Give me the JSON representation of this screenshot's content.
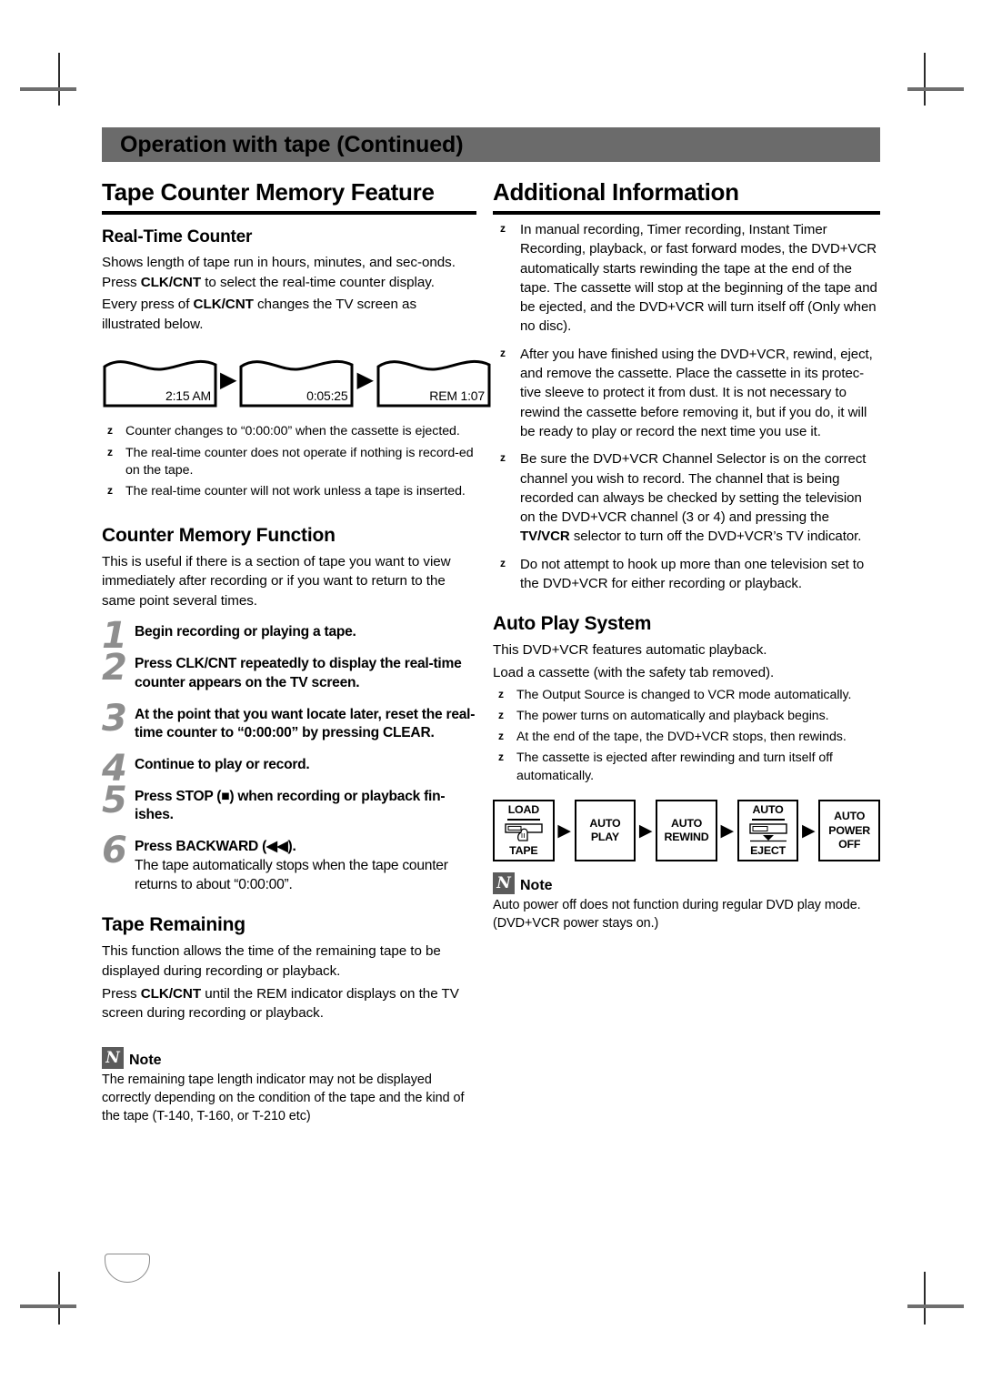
{
  "banner": {
    "title": "Operation with tape (Continued)"
  },
  "left": {
    "section_title": "Tape Counter Memory Feature",
    "realtime": {
      "heading": "Real-Time Counter",
      "p1_a": "Shows length of tape run in hours, minutes, and sec-onds. Press ",
      "p1_b": "CLK/CNT",
      "p1_c": " to select the real-time counter display.",
      "p2_a": "Every press of ",
      "p2_b": "CLK/CNT",
      "p2_c": " changes the TV screen as illustrated below.",
      "screens": [
        {
          "value": "2:15 AM"
        },
        {
          "value": "0:05:25"
        },
        {
          "value": "REM 1:07"
        }
      ],
      "arrow_glyph": "▶",
      "bullets": [
        "Counter changes to “0:00:00” when the cassette is ejected.",
        "The real-time counter does not operate if nothing is record-ed on the tape.",
        "The real-time counter will not work unless a tape is inserted."
      ]
    },
    "memory": {
      "heading": "Counter Memory Function",
      "intro": "This is useful if there is a section of tape you want to view immediately after recording or if you want to return to the same point several times.",
      "steps": [
        {
          "num": "1",
          "text": "Begin recording or playing a tape."
        },
        {
          "num": "2",
          "text": "Press CLK/CNT repeatedly to display the real-time counter appears on the TV screen."
        },
        {
          "num": "3",
          "text": "At the point that you want locate later, reset the real-time counter to “0:00:00” by pressing CLEAR."
        },
        {
          "num": "4",
          "text": "Continue to play or record."
        },
        {
          "num": "5",
          "text": "Press STOP (■) when recording or playback fin-ishes."
        },
        {
          "num": "6",
          "text": "Press BACKWARD (◀◀).",
          "text2": "The tape automatically stops when the tape counter returns to about “0:00:00”."
        }
      ]
    },
    "remaining": {
      "heading": "Tape Remaining",
      "p1": "This function allows the time of the remaining tape to be displayed during recording or playback.",
      "p2_a": "Press ",
      "p2_b": "CLK/CNT",
      "p2_c": " until the REM indicator displays on the TV screen during recording or playback.",
      "note_icon": "N",
      "note_label": "Note",
      "note_body": "The remaining tape length indicator may not be displayed correctly depending on the condition of the tape and the kind of the tape (T-140, T-160, or T-210 etc)"
    }
  },
  "right": {
    "section_title": "Additional Information",
    "bullets": [
      "In manual recording, Timer recording, Instant Timer Recording, playback, or fast forward modes, the DVD+VCR automatically starts rewinding the tape at the end of the tape. The cassette will stop at the beginning of the tape and be ejected, and the DVD+VCR will turn itself off (Only when no disc).",
      "After you have finished using the DVD+VCR, rewind, eject, and remove the cassette. Place the cassette in its protec-tive sleeve to protect it from dust. It is not necessary to rewind the cassette before removing it, but if you do, it will be ready to play or record the next time you use it.",
      "Do not attempt to hook up more than one television set to the DVD+VCR for either recording or playback."
    ],
    "bullet_channel": {
      "part1": "Be sure the DVD+VCR Channel Selector is on the correct channel you wish to record. The channel that is being recorded can always be checked by setting the television on the DVD+VCR channel (3 or 4) and pressing the ",
      "bold": "TV/VCR",
      "part2": " selector to turn off the DVD+VCR’s TV indicator."
    },
    "autoplay": {
      "heading": "Auto Play System",
      "p1": "This DVD+VCR features automatic playback.",
      "p2": "Load a cassette (with the safety tab removed).",
      "bullets": [
        "The Output Source is changed to VCR mode automatically.",
        "The power turns on automatically and playback begins.",
        "At the end of the tape, the DVD+VCR stops, then rewinds.",
        "The cassette is ejected after rewinding and turn itself off automatically."
      ],
      "flow": [
        {
          "top": "LOAD",
          "bottom": "TAPE",
          "icon": "load-tape-deck-icon"
        },
        {
          "line1": "AUTO",
          "line2": "PLAY"
        },
        {
          "line1": "AUTO",
          "line2": "REWIND"
        },
        {
          "top": "AUTO",
          "bottom": "EJECT",
          "icon": "auto-eject-deck-icon"
        },
        {
          "line1": "AUTO",
          "line2": "POWER",
          "line3": "OFF"
        }
      ],
      "arrow_glyph": "▶",
      "note_icon": "N",
      "note_label": "Note",
      "note_body": "Auto power off does not function during regular DVD play mode. (DVD+VCR power stays on.)"
    }
  },
  "bullet_glyph": "z"
}
